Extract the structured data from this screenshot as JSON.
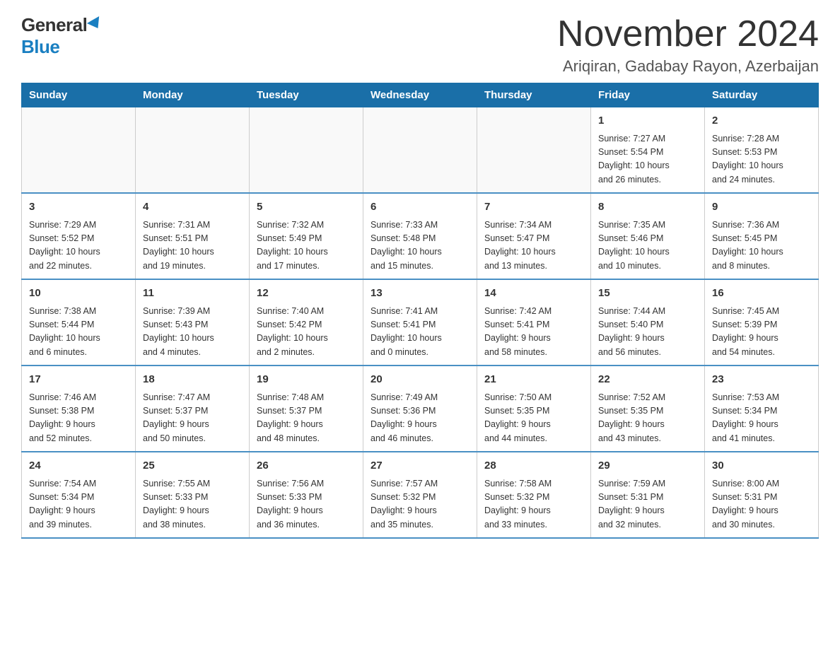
{
  "logo": {
    "general": "General",
    "blue": "Blue"
  },
  "title": "November 2024",
  "subtitle": "Ariqiran, Gadabay Rayon, Azerbaijan",
  "weekdays": [
    "Sunday",
    "Monday",
    "Tuesday",
    "Wednesday",
    "Thursday",
    "Friday",
    "Saturday"
  ],
  "weeks": [
    [
      {
        "day": "",
        "info": ""
      },
      {
        "day": "",
        "info": ""
      },
      {
        "day": "",
        "info": ""
      },
      {
        "day": "",
        "info": ""
      },
      {
        "day": "",
        "info": ""
      },
      {
        "day": "1",
        "info": "Sunrise: 7:27 AM\nSunset: 5:54 PM\nDaylight: 10 hours\nand 26 minutes."
      },
      {
        "day": "2",
        "info": "Sunrise: 7:28 AM\nSunset: 5:53 PM\nDaylight: 10 hours\nand 24 minutes."
      }
    ],
    [
      {
        "day": "3",
        "info": "Sunrise: 7:29 AM\nSunset: 5:52 PM\nDaylight: 10 hours\nand 22 minutes."
      },
      {
        "day": "4",
        "info": "Sunrise: 7:31 AM\nSunset: 5:51 PM\nDaylight: 10 hours\nand 19 minutes."
      },
      {
        "day": "5",
        "info": "Sunrise: 7:32 AM\nSunset: 5:49 PM\nDaylight: 10 hours\nand 17 minutes."
      },
      {
        "day": "6",
        "info": "Sunrise: 7:33 AM\nSunset: 5:48 PM\nDaylight: 10 hours\nand 15 minutes."
      },
      {
        "day": "7",
        "info": "Sunrise: 7:34 AM\nSunset: 5:47 PM\nDaylight: 10 hours\nand 13 minutes."
      },
      {
        "day": "8",
        "info": "Sunrise: 7:35 AM\nSunset: 5:46 PM\nDaylight: 10 hours\nand 10 minutes."
      },
      {
        "day": "9",
        "info": "Sunrise: 7:36 AM\nSunset: 5:45 PM\nDaylight: 10 hours\nand 8 minutes."
      }
    ],
    [
      {
        "day": "10",
        "info": "Sunrise: 7:38 AM\nSunset: 5:44 PM\nDaylight: 10 hours\nand 6 minutes."
      },
      {
        "day": "11",
        "info": "Sunrise: 7:39 AM\nSunset: 5:43 PM\nDaylight: 10 hours\nand 4 minutes."
      },
      {
        "day": "12",
        "info": "Sunrise: 7:40 AM\nSunset: 5:42 PM\nDaylight: 10 hours\nand 2 minutes."
      },
      {
        "day": "13",
        "info": "Sunrise: 7:41 AM\nSunset: 5:41 PM\nDaylight: 10 hours\nand 0 minutes."
      },
      {
        "day": "14",
        "info": "Sunrise: 7:42 AM\nSunset: 5:41 PM\nDaylight: 9 hours\nand 58 minutes."
      },
      {
        "day": "15",
        "info": "Sunrise: 7:44 AM\nSunset: 5:40 PM\nDaylight: 9 hours\nand 56 minutes."
      },
      {
        "day": "16",
        "info": "Sunrise: 7:45 AM\nSunset: 5:39 PM\nDaylight: 9 hours\nand 54 minutes."
      }
    ],
    [
      {
        "day": "17",
        "info": "Sunrise: 7:46 AM\nSunset: 5:38 PM\nDaylight: 9 hours\nand 52 minutes."
      },
      {
        "day": "18",
        "info": "Sunrise: 7:47 AM\nSunset: 5:37 PM\nDaylight: 9 hours\nand 50 minutes."
      },
      {
        "day": "19",
        "info": "Sunrise: 7:48 AM\nSunset: 5:37 PM\nDaylight: 9 hours\nand 48 minutes."
      },
      {
        "day": "20",
        "info": "Sunrise: 7:49 AM\nSunset: 5:36 PM\nDaylight: 9 hours\nand 46 minutes."
      },
      {
        "day": "21",
        "info": "Sunrise: 7:50 AM\nSunset: 5:35 PM\nDaylight: 9 hours\nand 44 minutes."
      },
      {
        "day": "22",
        "info": "Sunrise: 7:52 AM\nSunset: 5:35 PM\nDaylight: 9 hours\nand 43 minutes."
      },
      {
        "day": "23",
        "info": "Sunrise: 7:53 AM\nSunset: 5:34 PM\nDaylight: 9 hours\nand 41 minutes."
      }
    ],
    [
      {
        "day": "24",
        "info": "Sunrise: 7:54 AM\nSunset: 5:34 PM\nDaylight: 9 hours\nand 39 minutes."
      },
      {
        "day": "25",
        "info": "Sunrise: 7:55 AM\nSunset: 5:33 PM\nDaylight: 9 hours\nand 38 minutes."
      },
      {
        "day": "26",
        "info": "Sunrise: 7:56 AM\nSunset: 5:33 PM\nDaylight: 9 hours\nand 36 minutes."
      },
      {
        "day": "27",
        "info": "Sunrise: 7:57 AM\nSunset: 5:32 PM\nDaylight: 9 hours\nand 35 minutes."
      },
      {
        "day": "28",
        "info": "Sunrise: 7:58 AM\nSunset: 5:32 PM\nDaylight: 9 hours\nand 33 minutes."
      },
      {
        "day": "29",
        "info": "Sunrise: 7:59 AM\nSunset: 5:31 PM\nDaylight: 9 hours\nand 32 minutes."
      },
      {
        "day": "30",
        "info": "Sunrise: 8:00 AM\nSunset: 5:31 PM\nDaylight: 9 hours\nand 30 minutes."
      }
    ]
  ]
}
